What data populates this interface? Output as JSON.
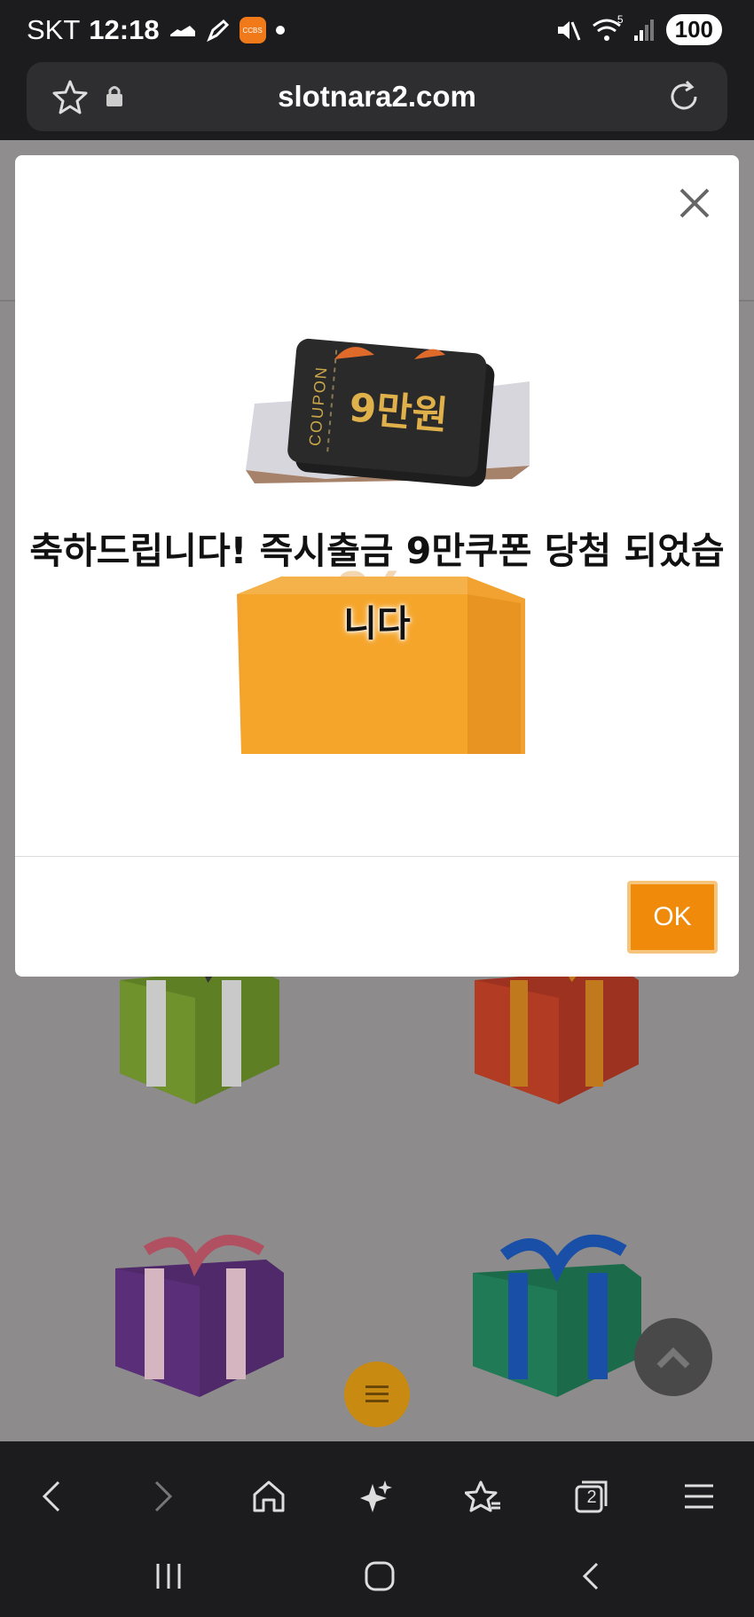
{
  "status_bar": {
    "carrier": "SKT",
    "time": "12:18",
    "battery": "100",
    "icons": [
      "shoe-icon",
      "pen-icon",
      "app-ccbs-icon",
      "dot-icon",
      "mute-icon",
      "wifi-icon",
      "signal-icon"
    ],
    "app_badge_text": "CCBS",
    "wifi_label": "5"
  },
  "browser": {
    "url": "slotnara2.com",
    "icons": [
      "star-icon",
      "lock-icon",
      "reload-icon"
    ]
  },
  "modal": {
    "message_line1": "축하드립니다! 즉시출금 9만쿠폰 당첨 되었습",
    "message_line2": "니다",
    "coupon_label": "COUPON",
    "coupon_value": "9만원",
    "ok_label": "OK",
    "colors": {
      "ok_bg": "#f08a0b",
      "ok_border": "#f6c47a"
    }
  },
  "page": {
    "gifts": [
      {
        "name": "green-gift",
        "color": "#6b8f2a"
      },
      {
        "name": "red-gift",
        "color": "#b33b22"
      },
      {
        "name": "purple-gift",
        "color": "#5b2e7a"
      },
      {
        "name": "teal-gift",
        "color": "#1f7a55"
      }
    ]
  },
  "bottom_nav": {
    "tabs_count": "2",
    "icons": [
      "back-icon",
      "forward-icon",
      "home-icon",
      "sparkle-icon",
      "bookmarks-icon",
      "tabs-icon",
      "menu-icon"
    ]
  },
  "system_nav": {
    "icons": [
      "recents-icon",
      "home-circle-icon",
      "back-arrow-icon"
    ]
  }
}
